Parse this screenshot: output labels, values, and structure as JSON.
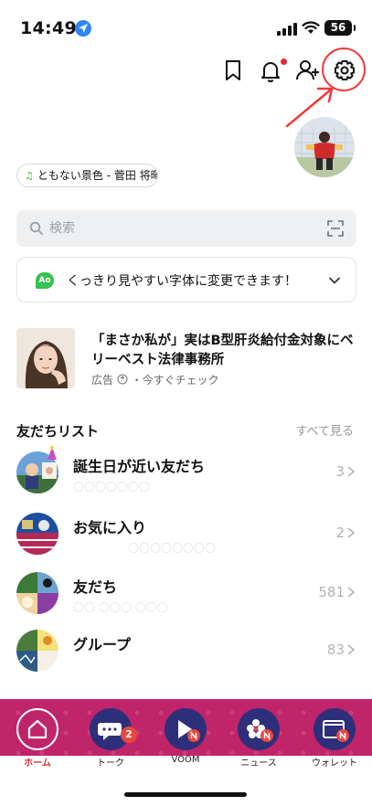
{
  "status_bar": {
    "time": "14:49",
    "battery": "56",
    "icons": [
      "location-arrow-icon",
      "signal-icon",
      "wifi-icon",
      "battery-icon"
    ]
  },
  "header": {
    "icons": [
      "bookmark-icon",
      "bell-icon",
      "add-friend-icon",
      "gear-icon"
    ],
    "notification_dot": true
  },
  "profile": {
    "music_chip": "ともない景色 - 菅田 将暉"
  },
  "search": {
    "placeholder": "検索"
  },
  "font_banner": {
    "badge": "Ao",
    "text": "くっきり見やすい字体に変更できます！"
  },
  "ad": {
    "title": "「まさか私が」実はB型肝炎給付金対象にベリーベスト法律事務所",
    "label": "広告",
    "cta": "・今すぐチェック"
  },
  "friends": {
    "title": "友だちリスト",
    "see_all": "すべて見る",
    "rows": [
      {
        "label": "誕生日が近い友だち",
        "count": "3"
      },
      {
        "label": "お気に入り",
        "count": "2"
      },
      {
        "label": "友だち",
        "count": "581"
      },
      {
        "label": "グループ",
        "count": "83"
      }
    ]
  },
  "bottom_nav": {
    "items": [
      {
        "label": "ホーム",
        "icon": "home-icon",
        "active": true,
        "badge": ""
      },
      {
        "label": "トーク",
        "icon": "chat-icon",
        "active": false,
        "badge": "2"
      },
      {
        "label": "VOOM",
        "icon": "voom-icon",
        "active": false,
        "badge": ""
      },
      {
        "label": "ニュース",
        "icon": "news-icon",
        "active": false,
        "badge": ""
      },
      {
        "label": "ウォレット",
        "icon": "wallet-icon",
        "active": false,
        "badge": ""
      }
    ]
  },
  "colors": {
    "accent_red": "#e5262f",
    "nav_band": "#c02469",
    "nav_circle": "#2d2f7a",
    "annotation": "#ef3a3a"
  }
}
